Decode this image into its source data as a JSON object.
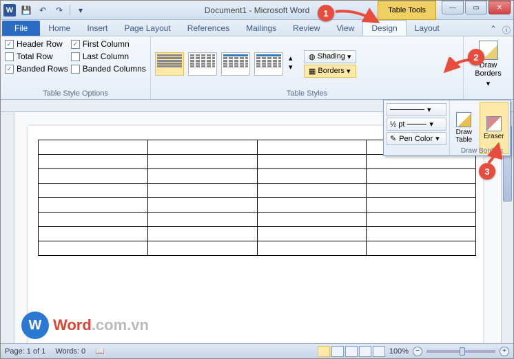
{
  "title": "Document1 - Microsoft Word",
  "table_tools": "Table Tools",
  "tabs": {
    "file": "File",
    "home": "Home",
    "insert": "Insert",
    "page_layout": "Page Layout",
    "references": "References",
    "mailings": "Mailings",
    "review": "Review",
    "view": "View",
    "design": "Design",
    "layout": "Layout"
  },
  "options": {
    "header_row": "Header Row",
    "total_row": "Total Row",
    "banded_rows": "Banded Rows",
    "first_column": "First Column",
    "last_column": "Last Column",
    "banded_columns": "Banded Columns",
    "group_label": "Table Style Options"
  },
  "styles": {
    "group_label": "Table Styles",
    "shading": "Shading",
    "borders": "Borders"
  },
  "draw": {
    "button": "Draw\nBorders",
    "line_weight": "½ pt",
    "pen_color": "Pen Color",
    "draw_table": "Draw\nTable",
    "eraser": "Eraser",
    "panel_label": "Draw Borders"
  },
  "status": {
    "page": "Page: 1 of 1",
    "words": "Words: 0",
    "zoom": "100%"
  },
  "watermark": {
    "letter": "W",
    "brand": "Word",
    "suffix": ".com.vn"
  },
  "callouts": {
    "one": "1",
    "two": "2",
    "three": "3"
  }
}
